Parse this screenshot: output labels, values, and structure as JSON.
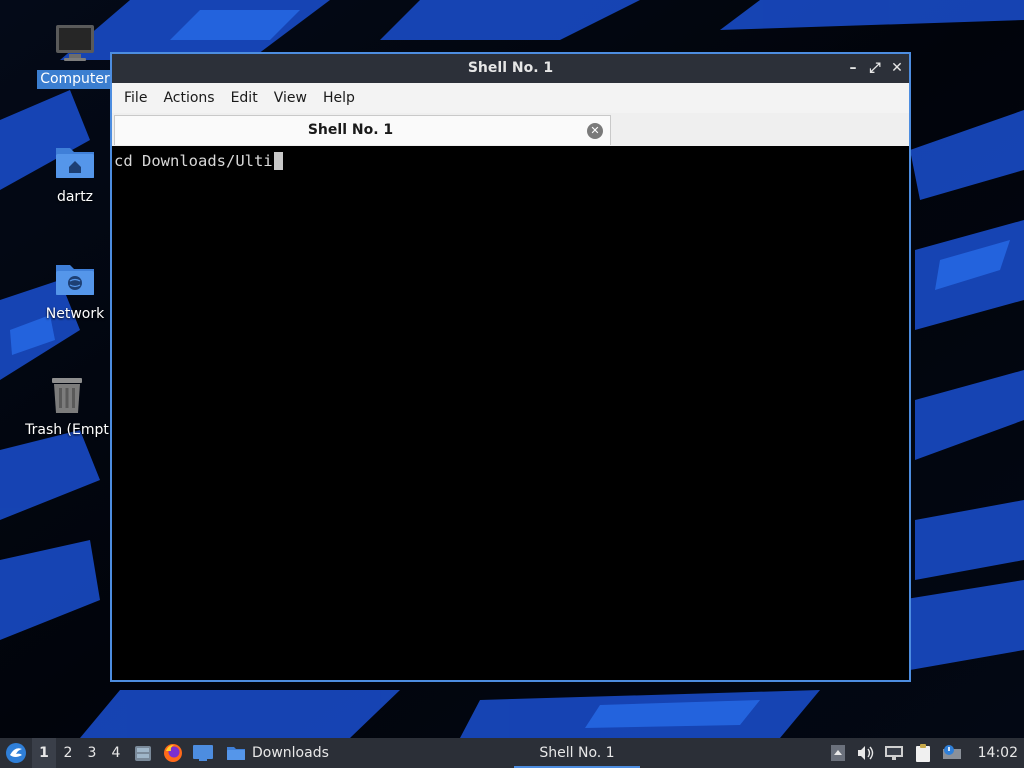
{
  "desktop": {
    "icons": [
      {
        "label": "Computer",
        "icon": "monitor-icon"
      },
      {
        "label": "dartz",
        "icon": "home-folder-icon"
      },
      {
        "label": "Network",
        "icon": "network-folder-icon"
      },
      {
        "label": "Trash (Empt",
        "icon": "trash-icon"
      }
    ]
  },
  "window": {
    "title": "Shell No. 1",
    "controls": {
      "minimize": "–",
      "maximize": "⤢",
      "close": "✕"
    },
    "menu": [
      "File",
      "Actions",
      "Edit",
      "View",
      "Help"
    ],
    "tab": {
      "label": "Shell No. 1",
      "close": "✕"
    },
    "terminal": {
      "line": "cd Downloads/Ulti"
    }
  },
  "taskbar": {
    "desktops": [
      "1",
      "2",
      "3",
      "4"
    ],
    "active_desktop": "1",
    "tasks": [
      {
        "label": "Downloads"
      },
      {
        "label": "Shell No. 1"
      }
    ],
    "clock": "14:02"
  },
  "colors": {
    "accent": "#4d8de0",
    "titlebar": "#2c3039",
    "taskbar": "#2b2f37",
    "selection": "#3b7ed0"
  }
}
